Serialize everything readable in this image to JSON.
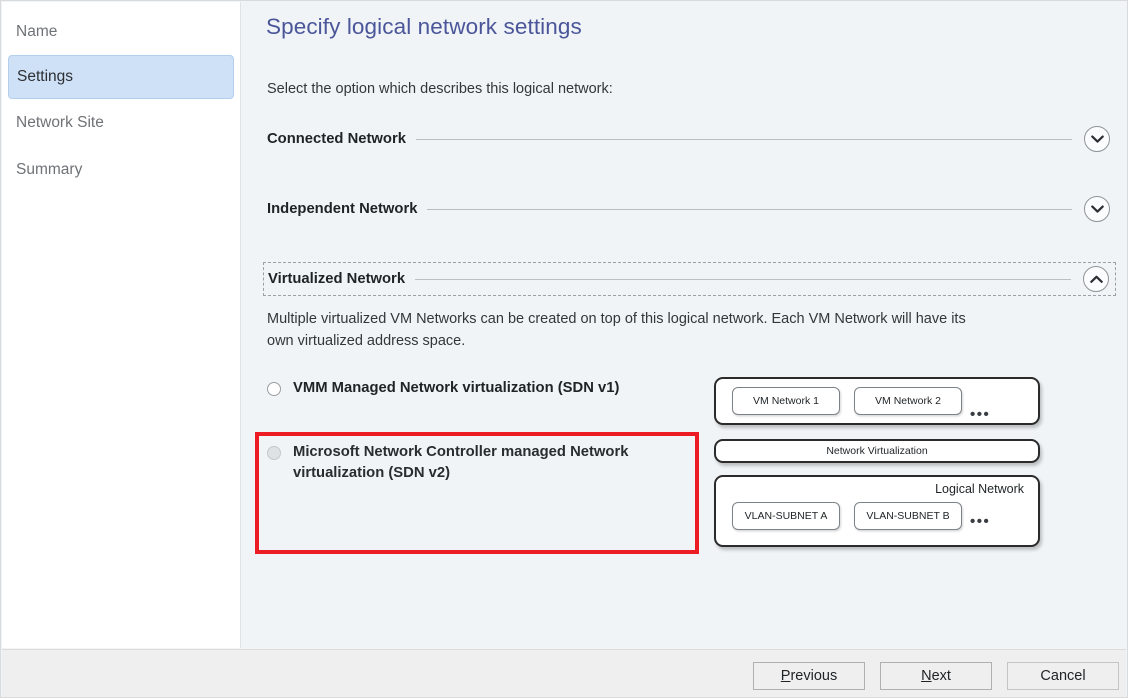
{
  "sidebar": {
    "items": [
      {
        "label": "Name",
        "selected": false
      },
      {
        "label": "Settings",
        "selected": true
      },
      {
        "label": "Network Site",
        "selected": false
      },
      {
        "label": "Summary",
        "selected": false
      }
    ]
  },
  "main": {
    "title": "Specify logical network settings",
    "intro": "Select the option which describes this logical network:",
    "sections": [
      {
        "title": "Connected Network",
        "state": "collapsed",
        "icon": "chevron-down-icon"
      },
      {
        "title": "Independent Network",
        "state": "collapsed",
        "icon": "chevron-down-icon"
      },
      {
        "title": "Virtualized Network",
        "state": "expanded",
        "icon": "chevron-up-icon",
        "focused": true
      }
    ],
    "virtualized": {
      "description": "Multiple virtualized VM Networks can be created on top of this logical network. Each VM Network will have its own virtualized address space.",
      "options": [
        {
          "label": "VMM Managed Network virtualization (SDN v1)",
          "selected": false,
          "disabled": false
        },
        {
          "label": "Microsoft Network Controller managed Network virtualization (SDN v2)",
          "selected": false,
          "disabled": true,
          "highlighted": true
        }
      ]
    }
  },
  "diagram": {
    "vm_network_boxes": [
      "VM Network 1",
      "VM Network 2"
    ],
    "vm_network_ellipsis": "•••",
    "network_virtualization_band": "Network Virtualization",
    "logical_network_caption": "Logical  Network",
    "vlan_subnet_boxes": [
      "VLAN-SUBNET A",
      "VLAN-SUBNET B"
    ],
    "vlan_ellipsis": "•••"
  },
  "footer": {
    "buttons": [
      {
        "label": "Previous",
        "mnemonic": "P"
      },
      {
        "label": "Next",
        "mnemonic": "N"
      },
      {
        "label": "Cancel",
        "mnemonic": ""
      }
    ]
  },
  "colors": {
    "title": "#4a5699",
    "selected_nav_bg": "#cfe1f6",
    "content_bg": "#f0f4f7",
    "footer_bg": "#efefef",
    "highlight_border": "#ed1c24"
  }
}
